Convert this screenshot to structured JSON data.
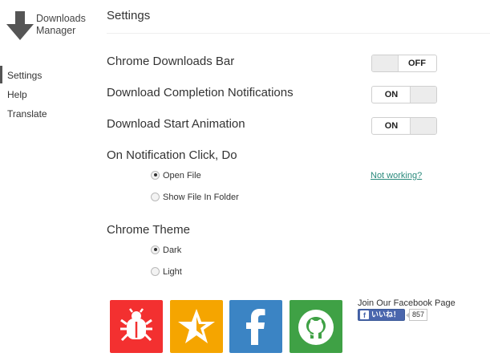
{
  "app": {
    "name_line1": "Downloads",
    "name_line2": "Manager"
  },
  "sidebar": {
    "items": [
      {
        "label": "Settings",
        "active": true
      },
      {
        "label": "Help",
        "active": false
      },
      {
        "label": "Translate",
        "active": false
      }
    ]
  },
  "main": {
    "title": "Settings",
    "settings": {
      "downloads_bar": {
        "label": "Chrome Downloads Bar",
        "state": "OFF"
      },
      "completion_notifications": {
        "label": "Download Completion Notifications",
        "state": "ON"
      },
      "start_animation": {
        "label": "Download Start Animation",
        "state": "ON"
      }
    },
    "notification_click": {
      "label": "On Notification Click, Do",
      "options": [
        {
          "label": "Open File",
          "checked": true
        },
        {
          "label": "Show File In Folder",
          "checked": false
        }
      ],
      "help_link": "Not working?"
    },
    "theme": {
      "label": "Chrome Theme",
      "options": [
        {
          "label": "Dark",
          "checked": true
        },
        {
          "label": "Light",
          "checked": false
        }
      ]
    }
  },
  "footer": {
    "tiles": [
      {
        "icon": "bug-icon",
        "color": "#f33030"
      },
      {
        "icon": "star-icon",
        "color": "#f5a500"
      },
      {
        "icon": "facebook-icon",
        "color": "#3b84c4"
      },
      {
        "icon": "github-icon",
        "color": "#3fa145"
      }
    ],
    "facebook": {
      "caption": "Join Our Facebook Page",
      "like_label": "いいね！",
      "like_icon": "f",
      "count": "857"
    }
  }
}
